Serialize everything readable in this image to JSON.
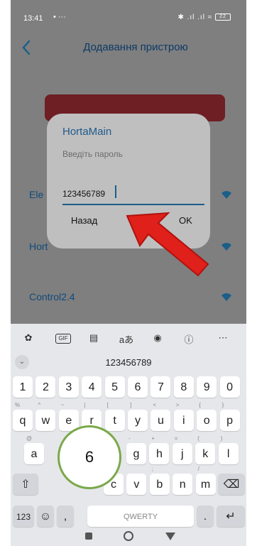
{
  "status_bar": {
    "time": "13:41",
    "indicators": "•  ···",
    "signal": "✱ .ıl .ıl",
    "battery": "22"
  },
  "header": {
    "title": "Додавання пристрою",
    "back_icon": "chevron-left-icon"
  },
  "networks": [
    {
      "name": "Ele"
    },
    {
      "name": "Hort"
    },
    {
      "name": "Control2.4"
    }
  ],
  "dialog": {
    "title": "HortaMain",
    "hint": "Введіть пароль",
    "password_value": "123456789",
    "cancel_label": "Назад",
    "ok_label": "OK"
  },
  "keyboard": {
    "suggestion": "123456789",
    "row_numbers": [
      "1",
      "2",
      "3",
      "4",
      "5",
      "6",
      "7",
      "8",
      "9",
      "0"
    ],
    "row_top": [
      {
        "k": "q",
        "s": "%"
      },
      {
        "k": "w",
        "s": "^"
      },
      {
        "k": "e",
        "s": "~"
      },
      {
        "k": "r",
        "s": "|"
      },
      {
        "k": "t",
        "s": "["
      },
      {
        "k": "y",
        "s": "]"
      },
      {
        "k": "u",
        "s": "<"
      },
      {
        "k": "i",
        "s": ">"
      },
      {
        "k": "o",
        "s": "{"
      },
      {
        "k": "p",
        "s": "}"
      }
    ],
    "row_mid": [
      {
        "k": "a",
        "s": "@"
      },
      {
        "k": "g",
        "s": "-"
      },
      {
        "k": "h",
        "s": "+"
      },
      {
        "k": "j",
        "s": "="
      },
      {
        "k": "k",
        "s": "("
      },
      {
        "k": "l",
        "s": ")"
      }
    ],
    "row_bottom": [
      {
        "k": "c",
        "s": ""
      },
      {
        "k": "v",
        "s": ""
      },
      {
        "k": "b",
        "s": ";"
      },
      {
        "k": "n",
        "s": ""
      },
      {
        "k": "m",
        "s": "/"
      }
    ],
    "num_label": "123",
    "space_label": "QWERTY",
    "comma_label": ",",
    "period_label": "."
  },
  "annotation": {
    "step_number": "6"
  },
  "colors": {
    "accent": "#1b5e89",
    "title": "#0d3a66",
    "arrow": "#e0201a",
    "circle": "#7aa94a"
  }
}
